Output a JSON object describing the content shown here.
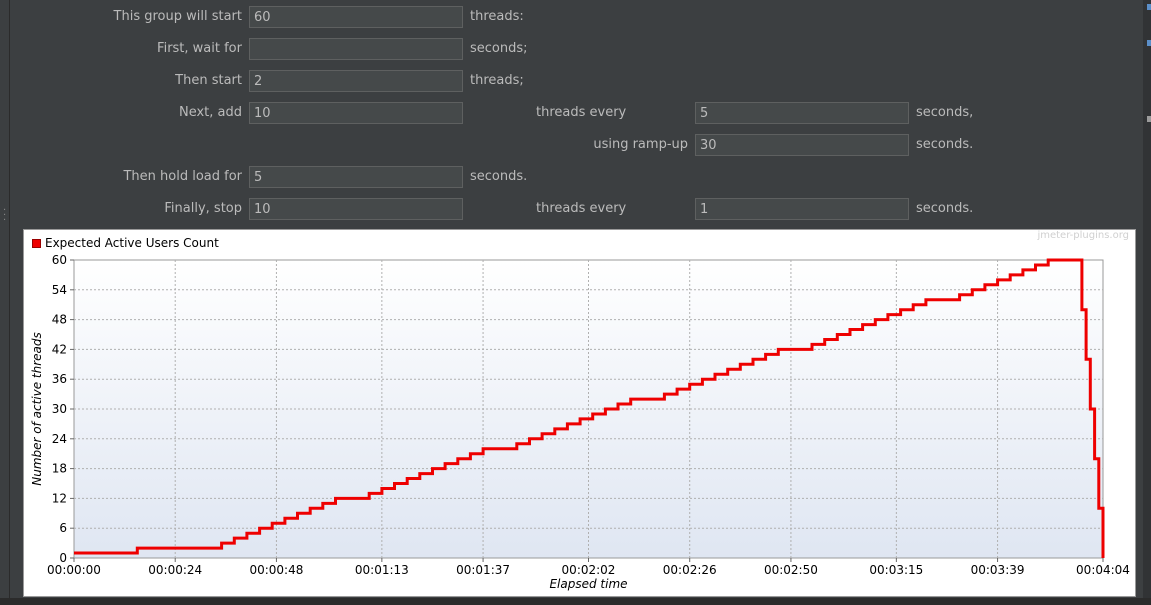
{
  "form": {
    "start_label": "This group will start",
    "start_value": "60",
    "start_unit": "threads:",
    "wait_label": "First, wait for",
    "wait_value": "",
    "wait_unit": "seconds;",
    "then_start_label": "Then start",
    "then_start_value": "2",
    "then_start_unit": "threads;",
    "next_add_label": "Next, add",
    "next_add_value": "10",
    "next_add_mid": "threads every",
    "next_add_every_value": "5",
    "next_add_every_unit": "seconds,",
    "ramp_label": "using ramp-up",
    "ramp_value": "30",
    "ramp_unit": "seconds.",
    "hold_label": "Then hold load for",
    "hold_value": "5",
    "hold_unit": "seconds.",
    "stop_label": "Finally, stop",
    "stop_value": "10",
    "stop_mid": "threads every",
    "stop_every_value": "1",
    "stop_every_unit": "seconds."
  },
  "chart_data": {
    "type": "line",
    "legend": "Expected Active Users Count",
    "watermark": "jmeter-plugins.org",
    "xlabel": "Elapsed time",
    "ylabel": "Number of active threads",
    "ylim": [
      0,
      60
    ],
    "yticks": [
      0,
      6,
      12,
      18,
      24,
      30,
      36,
      42,
      48,
      54,
      60
    ],
    "xlim_seconds": [
      0,
      244
    ],
    "xtick_seconds": [
      0,
      24,
      48,
      73,
      97,
      122,
      146,
      170,
      195,
      219,
      244
    ],
    "xtick_labels": [
      "00:00:00",
      "00:00:24",
      "00:00:48",
      "00:01:13",
      "00:01:37",
      "00:02:02",
      "00:02:26",
      "00:02:50",
      "00:03:15",
      "00:03:39",
      "00:04:04"
    ],
    "line_color": "#ee0000",
    "grid": true,
    "series": [
      {
        "name": "Expected Active Users Count",
        "points": [
          [
            0,
            1
          ],
          [
            15,
            1
          ],
          [
            15,
            2
          ],
          [
            35,
            2
          ],
          [
            35,
            3
          ],
          [
            38,
            3
          ],
          [
            38,
            4
          ],
          [
            41,
            4
          ],
          [
            41,
            5
          ],
          [
            44,
            5
          ],
          [
            44,
            6
          ],
          [
            47,
            6
          ],
          [
            47,
            7
          ],
          [
            50,
            7
          ],
          [
            50,
            8
          ],
          [
            53,
            8
          ],
          [
            53,
            9
          ],
          [
            56,
            9
          ],
          [
            56,
            10
          ],
          [
            59,
            10
          ],
          [
            59,
            11
          ],
          [
            62,
            11
          ],
          [
            62,
            12
          ],
          [
            70,
            12
          ],
          [
            70,
            13
          ],
          [
            73,
            13
          ],
          [
            73,
            14
          ],
          [
            76,
            14
          ],
          [
            76,
            15
          ],
          [
            79,
            15
          ],
          [
            79,
            16
          ],
          [
            82,
            16
          ],
          [
            82,
            17
          ],
          [
            85,
            17
          ],
          [
            85,
            18
          ],
          [
            88,
            18
          ],
          [
            88,
            19
          ],
          [
            91,
            19
          ],
          [
            91,
            20
          ],
          [
            94,
            20
          ],
          [
            94,
            21
          ],
          [
            97,
            21
          ],
          [
            97,
            22
          ],
          [
            105,
            22
          ],
          [
            105,
            23
          ],
          [
            108,
            23
          ],
          [
            108,
            24
          ],
          [
            111,
            24
          ],
          [
            111,
            25
          ],
          [
            114,
            25
          ],
          [
            114,
            26
          ],
          [
            117,
            26
          ],
          [
            117,
            27
          ],
          [
            120,
            27
          ],
          [
            120,
            28
          ],
          [
            123,
            28
          ],
          [
            123,
            29
          ],
          [
            126,
            29
          ],
          [
            126,
            30
          ],
          [
            129,
            30
          ],
          [
            129,
            31
          ],
          [
            132,
            31
          ],
          [
            132,
            32
          ],
          [
            140,
            32
          ],
          [
            140,
            33
          ],
          [
            143,
            33
          ],
          [
            143,
            34
          ],
          [
            146,
            34
          ],
          [
            146,
            35
          ],
          [
            149,
            35
          ],
          [
            149,
            36
          ],
          [
            152,
            36
          ],
          [
            152,
            37
          ],
          [
            155,
            37
          ],
          [
            155,
            38
          ],
          [
            158,
            38
          ],
          [
            158,
            39
          ],
          [
            161,
            39
          ],
          [
            161,
            40
          ],
          [
            164,
            40
          ],
          [
            164,
            41
          ],
          [
            167,
            41
          ],
          [
            167,
            42
          ],
          [
            175,
            42
          ],
          [
            175,
            43
          ],
          [
            178,
            43
          ],
          [
            178,
            44
          ],
          [
            181,
            44
          ],
          [
            181,
            45
          ],
          [
            184,
            45
          ],
          [
            184,
            46
          ],
          [
            187,
            46
          ],
          [
            187,
            47
          ],
          [
            190,
            47
          ],
          [
            190,
            48
          ],
          [
            193,
            48
          ],
          [
            193,
            49
          ],
          [
            196,
            49
          ],
          [
            196,
            50
          ],
          [
            199,
            50
          ],
          [
            199,
            51
          ],
          [
            202,
            51
          ],
          [
            202,
            52
          ],
          [
            210,
            52
          ],
          [
            210,
            53
          ],
          [
            213,
            53
          ],
          [
            213,
            54
          ],
          [
            216,
            54
          ],
          [
            216,
            55
          ],
          [
            219,
            55
          ],
          [
            219,
            56
          ],
          [
            222,
            56
          ],
          [
            222,
            57
          ],
          [
            225,
            57
          ],
          [
            225,
            58
          ],
          [
            228,
            58
          ],
          [
            228,
            59
          ],
          [
            231,
            59
          ],
          [
            231,
            60
          ],
          [
            239,
            60
          ],
          [
            239,
            50
          ],
          [
            240,
            50
          ],
          [
            240,
            40
          ],
          [
            241,
            40
          ],
          [
            241,
            30
          ],
          [
            242,
            30
          ],
          [
            242,
            20
          ],
          [
            243,
            20
          ],
          [
            243,
            10
          ],
          [
            244,
            10
          ],
          [
            244,
            0
          ]
        ]
      }
    ]
  }
}
